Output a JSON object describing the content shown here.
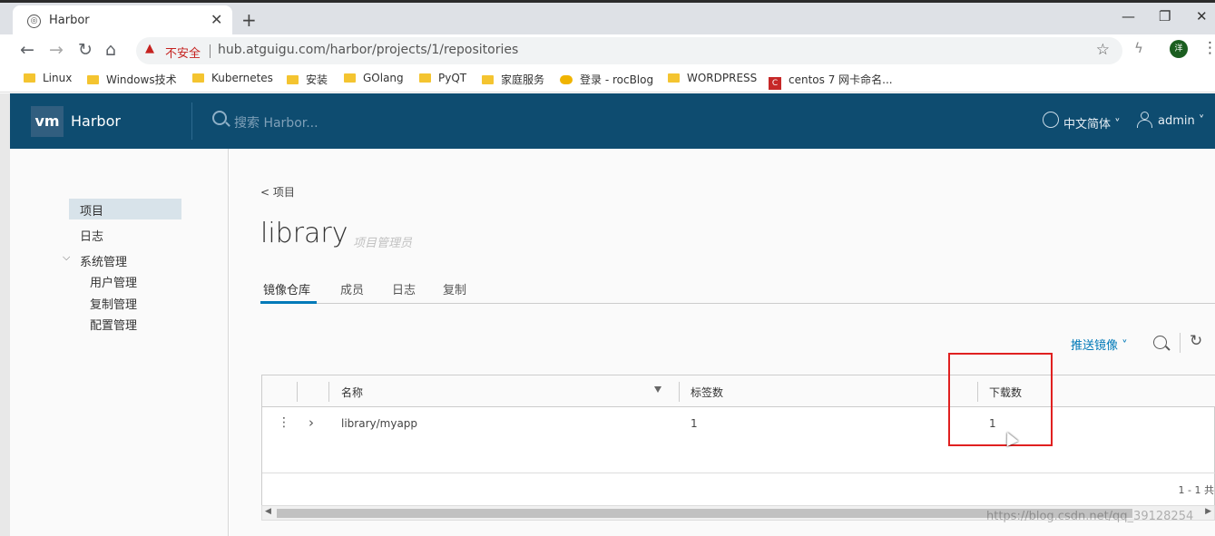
{
  "browser": {
    "tab_title": "Harbor",
    "tab_close": "✕",
    "new_tab": "+",
    "win_min": "—",
    "win_restore": "❐",
    "win_close": "✕",
    "nav_back": "←",
    "nav_forward": "→",
    "nav_reload": "↻",
    "nav_home": "⌂",
    "security_label": "不安全",
    "url": "hub.atguigu.com/harbor/projects/1/repositories",
    "star": "☆",
    "avatar_letter": "洋",
    "bookmarks": [
      "Linux",
      "Windows技术",
      "Kubernetes",
      "安装",
      "GOlang",
      "PyQT",
      "家庭服务",
      "登录 - rocBlog",
      "WORDPRESS",
      "centos 7 网卡命名..."
    ]
  },
  "harbor": {
    "logo": "vm",
    "title": "Harbor",
    "search_placeholder": "搜索 Harbor...",
    "language": "中文简体",
    "user": "admin"
  },
  "sidebar": {
    "items": [
      "项目",
      "日志",
      "系统管理"
    ],
    "admin_children": [
      "用户管理",
      "复制管理",
      "配置管理"
    ]
  },
  "main": {
    "breadcrumb": "< 项目",
    "project_name": "library",
    "role": "项目管理员",
    "tabs": [
      "镜像仓库",
      "成员",
      "日志",
      "复制"
    ],
    "push_image": "推送镜像",
    "columns": [
      "名称",
      "标签数",
      "下载数"
    ],
    "rows": [
      {
        "name": "library/myapp",
        "tags": "1",
        "pulls": "1"
      }
    ],
    "pagination": "1 - 1 共"
  },
  "watermark": "https://blog.csdn.net/qq_39128254",
  "colors": {
    "header_bg": "#0e4c70",
    "accent": "#0079b8",
    "highlight_box": "#e02020"
  }
}
